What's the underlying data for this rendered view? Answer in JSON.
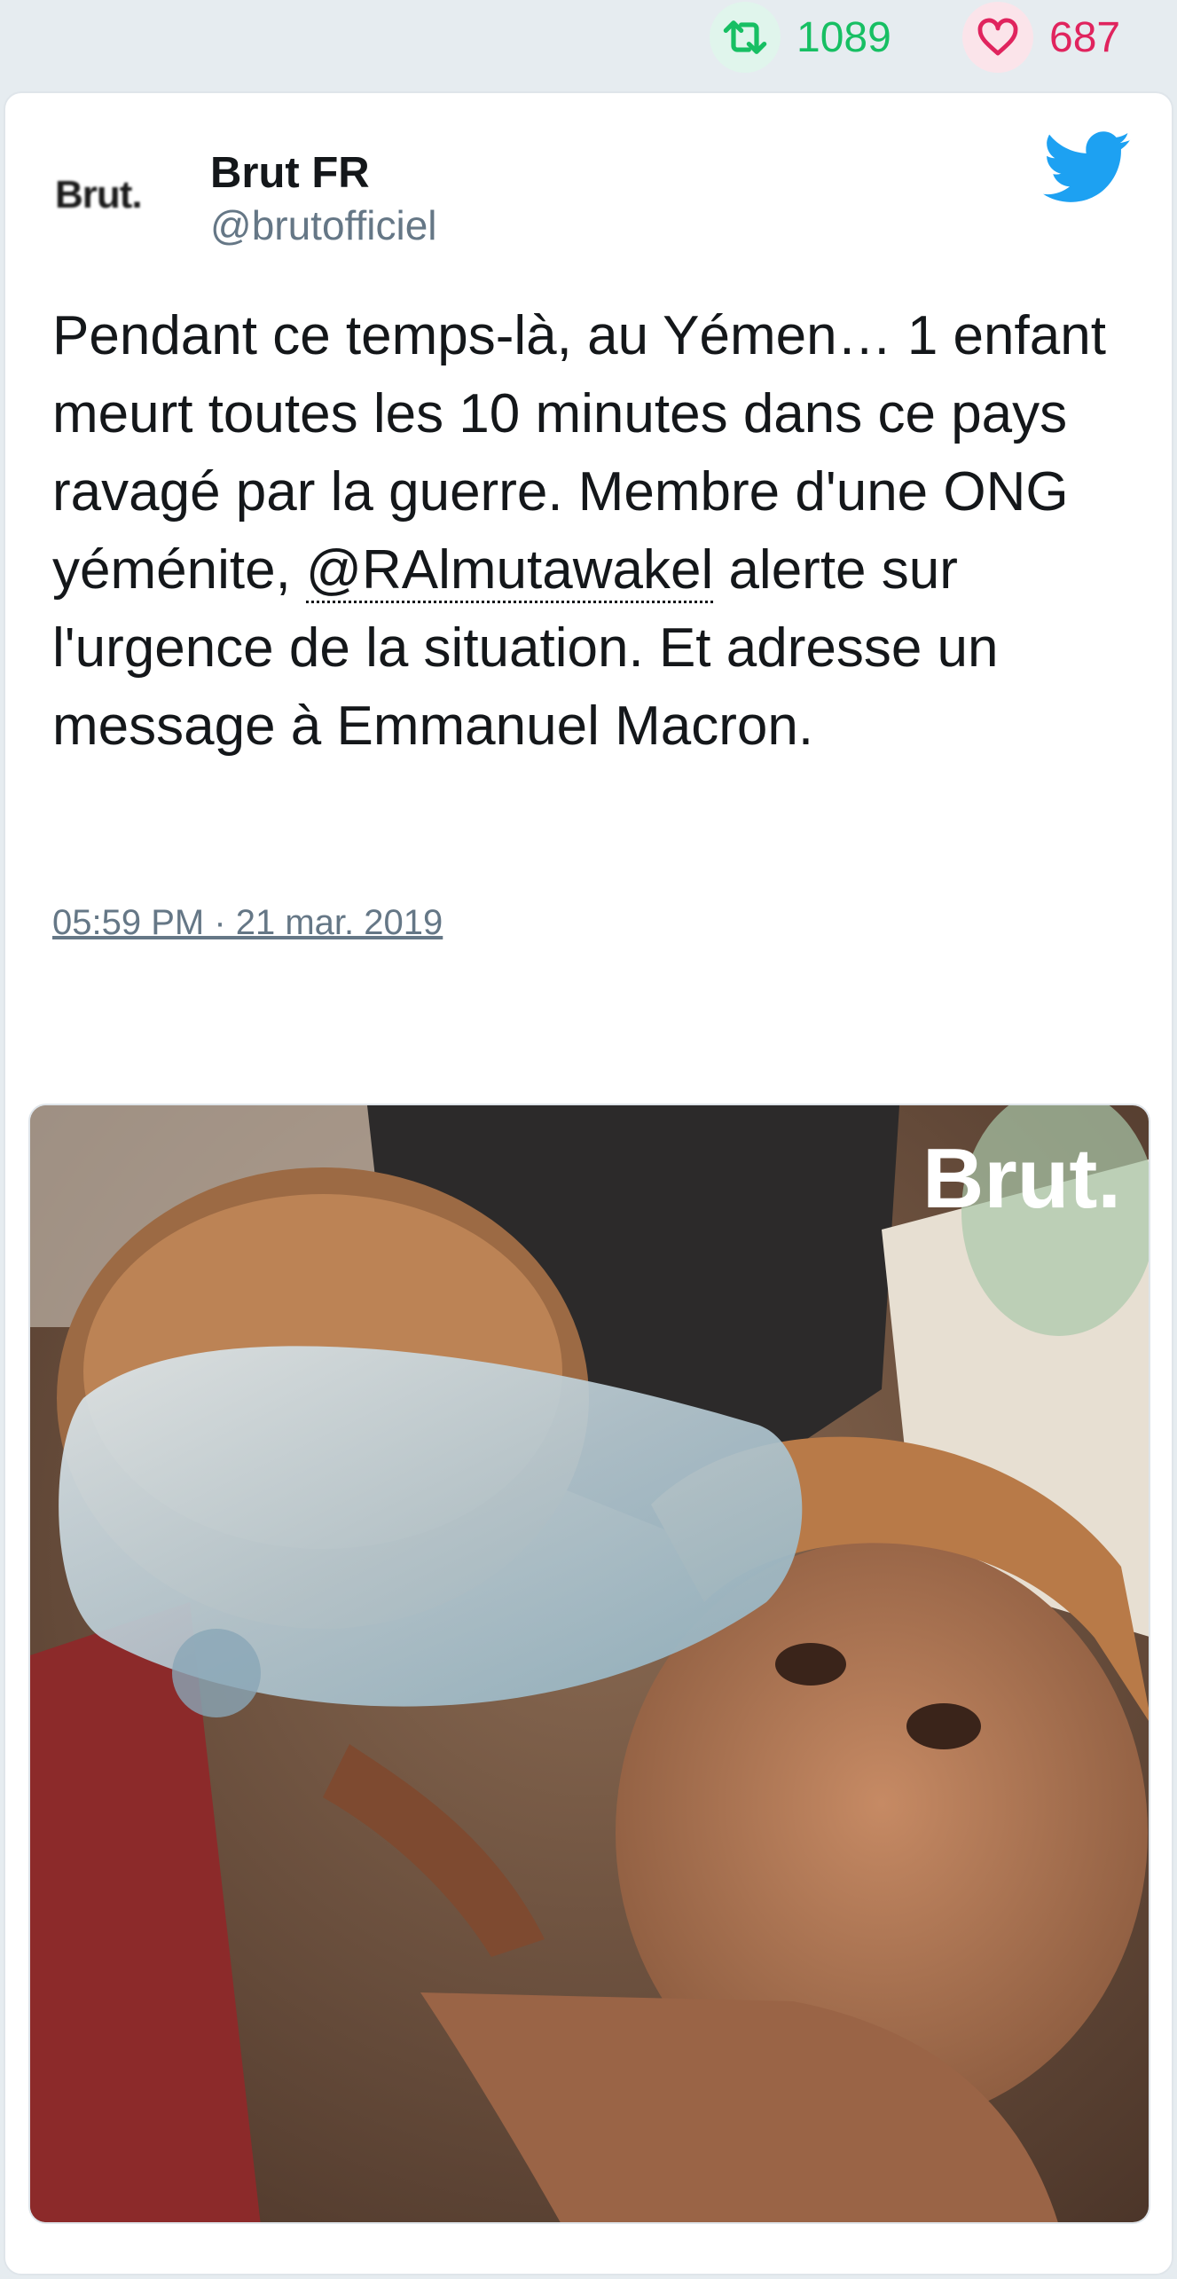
{
  "stats": {
    "retweets": "1089",
    "likes": "687"
  },
  "tweet": {
    "author_name": "Brut FR",
    "author_handle": "@brutofficiel",
    "avatar_text": "Brut.",
    "text_before_mention": "Pendant ce temps-là, au Yémen… 1 enfant meurt toutes les 10 minutes dans ce pays ravagé par la guerre. Membre d'une ONG yéménite, ",
    "mention": "@RAlmutawakel",
    "text_after_mention": " alerte sur l'urgence de la situation. Et adresse un message à Emmanuel Macron.",
    "timestamp": "05:59 PM · 21 mar. 2019",
    "media_watermark": "Brut."
  },
  "icons": {
    "retweet_stat": "retweet-icon",
    "like_stat": "heart-icon",
    "platform": "twitter-bird-icon",
    "reply": "reply-icon",
    "retweet": "retweet-icon",
    "like": "heart-icon"
  },
  "colors": {
    "retweet_green": "#17bf63",
    "like_red": "#e0245e",
    "twitter_blue": "#1da1f2",
    "text": "#14171a",
    "muted": "#657786"
  }
}
